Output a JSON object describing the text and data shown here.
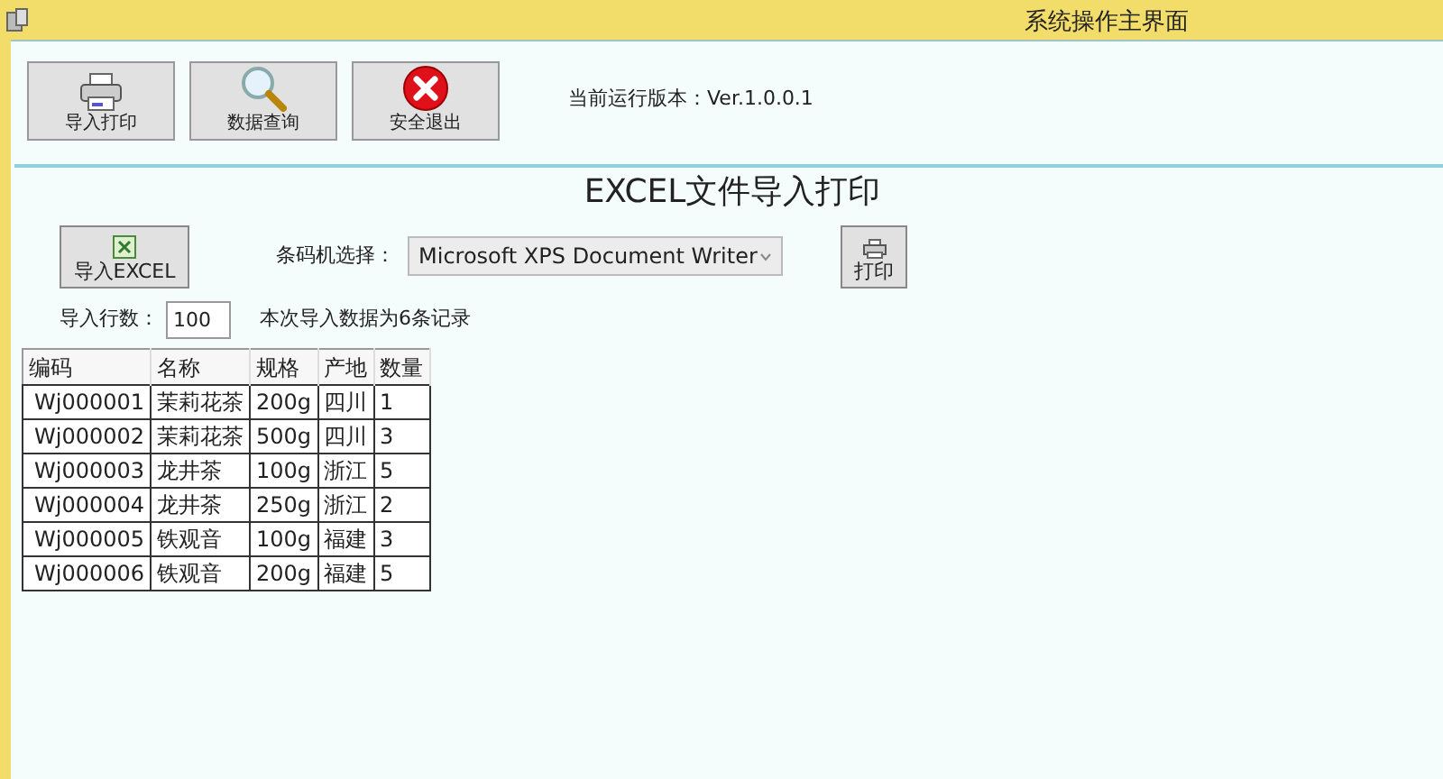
{
  "window": {
    "title": "系统操作主界面"
  },
  "toolbar": [
    {
      "kind": "printer",
      "label": "导入打印"
    },
    {
      "kind": "search",
      "label": "数据查询"
    },
    {
      "kind": "exit",
      "label": "安全退出"
    }
  ],
  "version": "当前运行版本：Ver.1.0.0.1",
  "heading": "EXCEL文件导入打印",
  "import_button": "导入EXCEL",
  "printer_label": "条码机选择：",
  "printer_select": "Microsoft XPS Document Writer",
  "print_button": "打印",
  "rows_label": "导入行数：",
  "rows_value": "100",
  "status": "本次导入数据为6条记录",
  "table": {
    "columns": [
      "编码",
      "名称",
      "规格",
      "产地",
      "数量"
    ],
    "rows": [
      [
        "Wj000001",
        "茉莉花茶",
        "200g",
        "四川",
        "1"
      ],
      [
        "Wj000002",
        "茉莉花茶",
        "500g",
        "四川",
        "3"
      ],
      [
        "Wj000003",
        "龙井茶",
        "100g",
        "浙江",
        "5"
      ],
      [
        "Wj000004",
        "龙井茶",
        "250g",
        "浙江",
        "2"
      ],
      [
        "Wj000005",
        "铁观音",
        "100g",
        "福建",
        "3"
      ],
      [
        "Wj000006",
        "铁观音",
        "200g",
        "福建",
        "5"
      ]
    ]
  }
}
